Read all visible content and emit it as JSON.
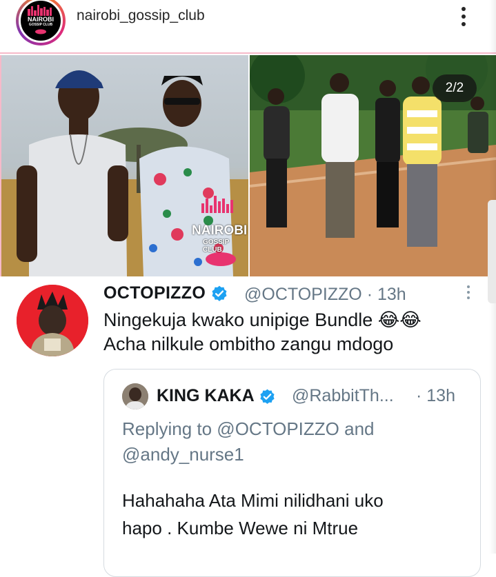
{
  "post": {
    "username": "nairobi_gossip_club",
    "avatar_logo_line1": "NAIROBI",
    "avatar_logo_line2": "GOSSIP CLUB",
    "image_counter": "2/2",
    "watermark_line1": "NAIROBI",
    "watermark_line2": "GOSSIP CLUB"
  },
  "tweet": {
    "display_name": "OCTOPIZZO",
    "handle": "@OCTOPIZZO",
    "time": "· 13h",
    "line1": "Ningekuja kwako unipige Bundle 😂😂",
    "line2": "Acha nilkule ombitho zangu mdogo",
    "quoted": {
      "display_name": "KING KAKA",
      "handle": "@RabbitTh...",
      "time": "· 13h",
      "reply_line1": "Replying to @OCTOPIZZO and",
      "reply_line2": "@andy_nurse1",
      "text_line1": "Hahahaha Ata Mimi nilidhani uko",
      "text_line2": "hapo . Kumbe Wewe ni Mtrue"
    }
  },
  "colors": {
    "verified": "#1da1f2",
    "ig_text": "#262626",
    "tweet_text": "#14171a",
    "muted": "#657786",
    "brand_pink": "#e8336f"
  },
  "icons": {
    "more": "more-vertical-icon",
    "verified": "verified-badge-icon"
  }
}
